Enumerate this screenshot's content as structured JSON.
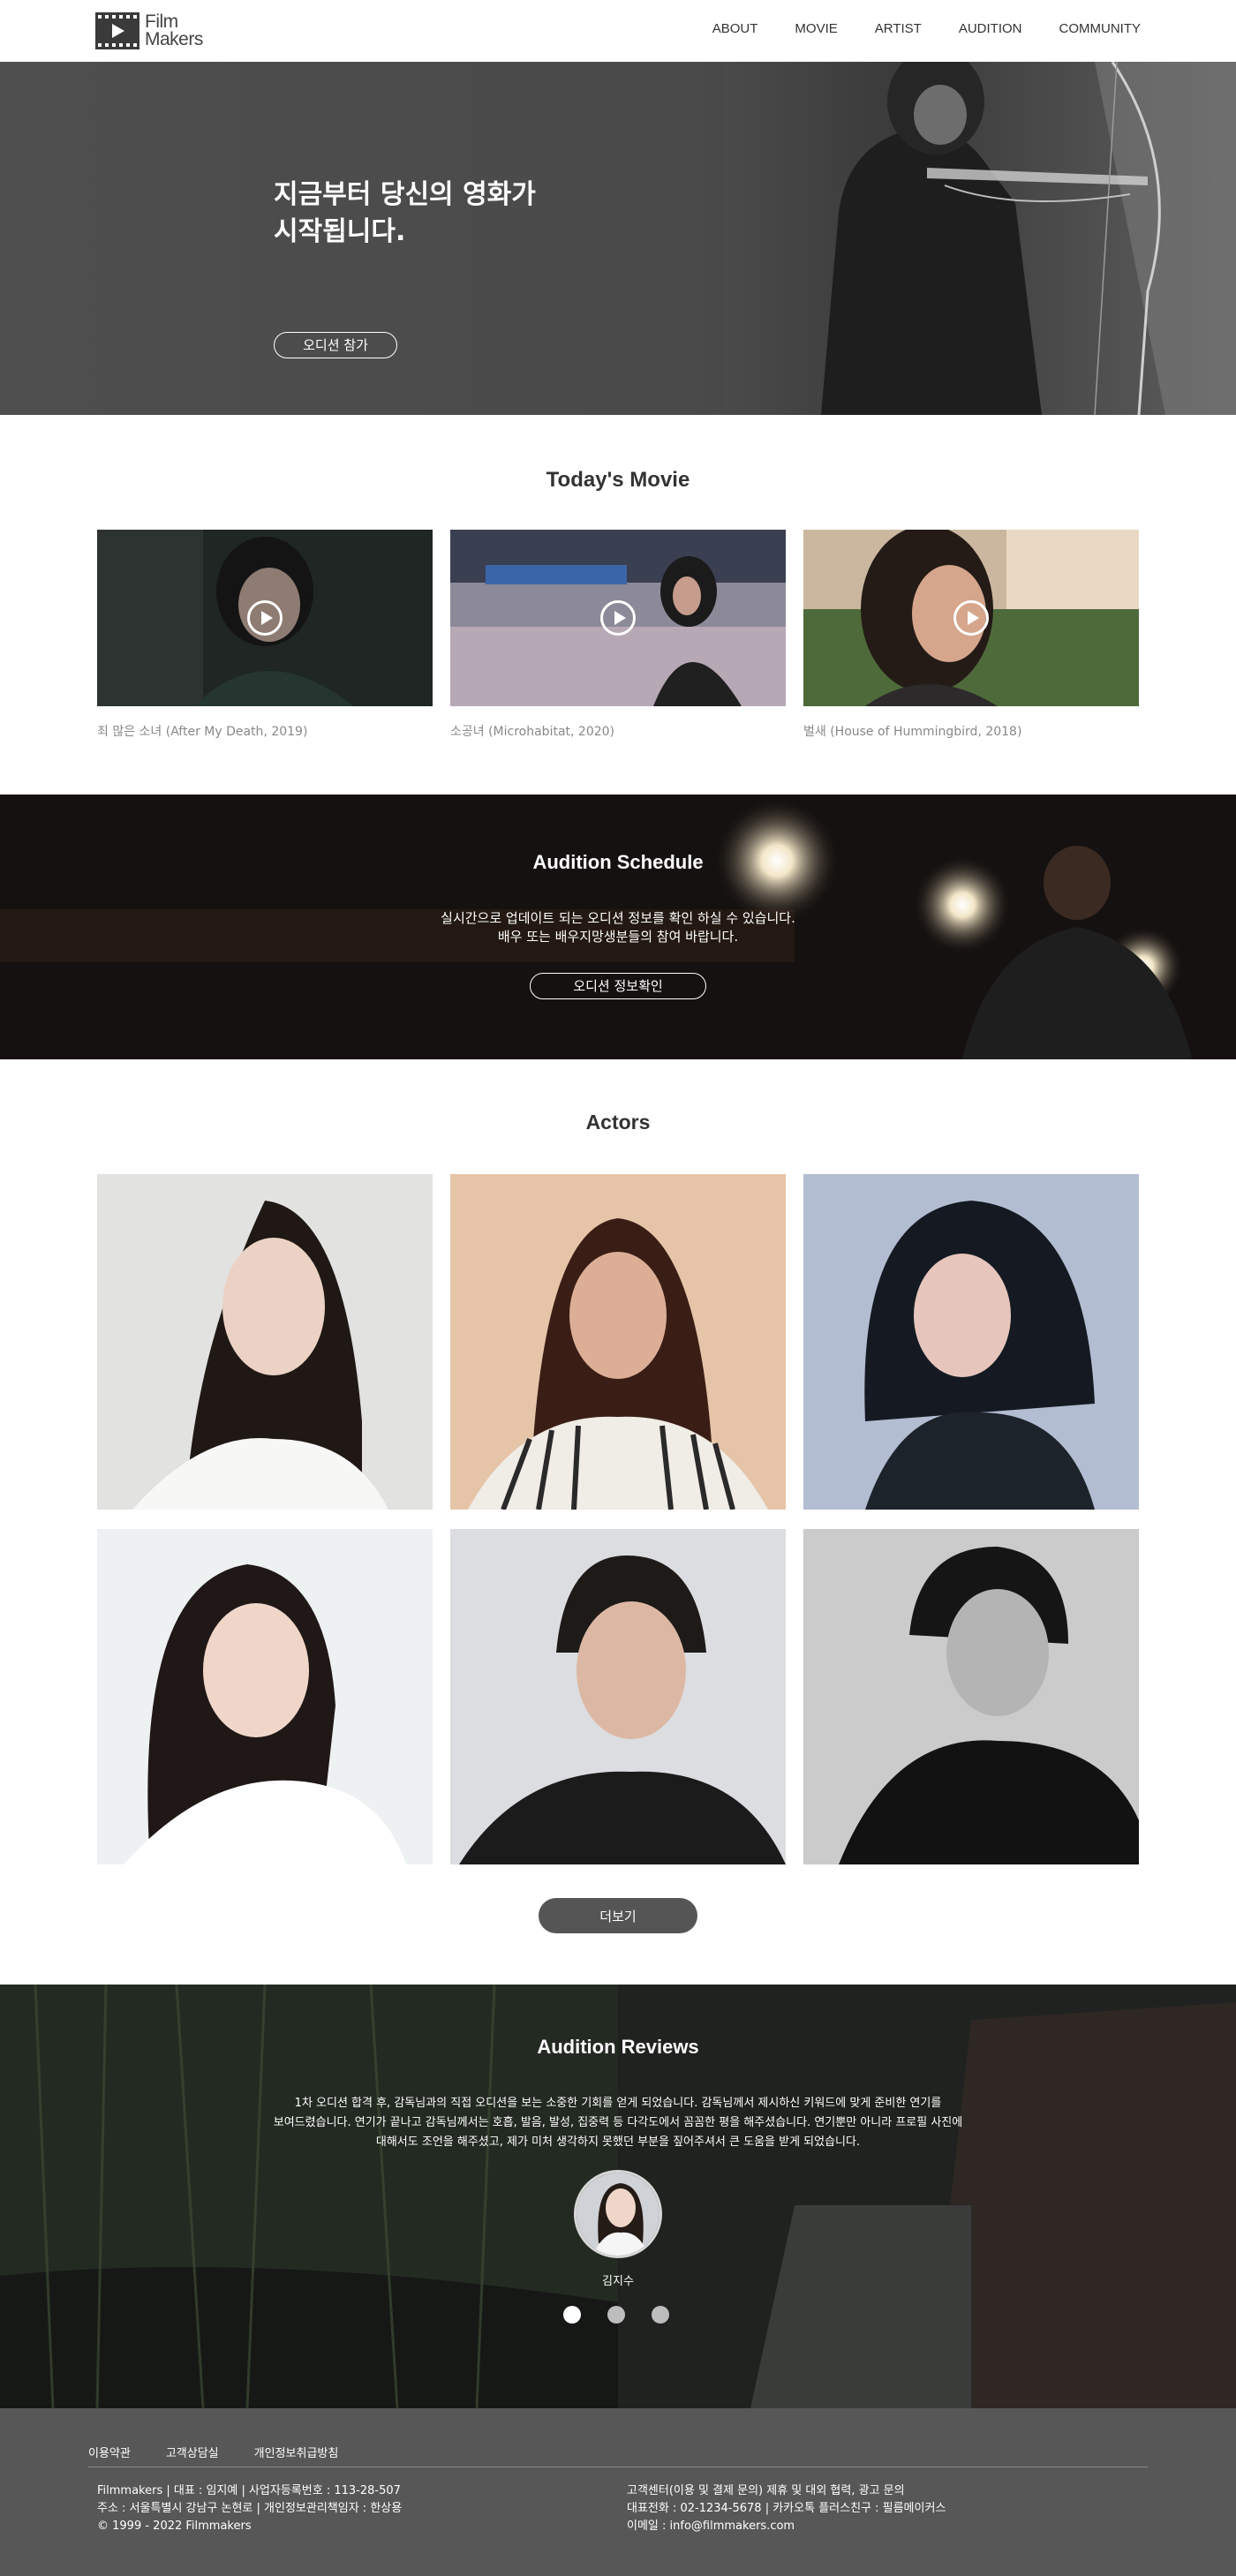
{
  "header": {
    "logo_line1": "Film",
    "logo_line2": "Makers",
    "nav": [
      "ABOUT",
      "MOVIE",
      "ARTIST",
      "AUDITION",
      "COMMUNITY"
    ]
  },
  "hero": {
    "title_line1": "지금부터 당신의 영화가",
    "title_line2": "시작됩니다.",
    "button": "오디션 참가"
  },
  "movies": {
    "title": "Today's Movie",
    "items": [
      {
        "caption": "죄 많은 소녀 (After My Death, 2019)"
      },
      {
        "caption": "소공녀 (Microhabitat, 2020)"
      },
      {
        "caption": "벌새 (House of Hummingbird, 2018)"
      }
    ]
  },
  "schedule": {
    "title": "Audition Schedule",
    "desc_line1": "실시간으로 업데이트 되는 오디션 정보를 확인 하실 수 있습니다.",
    "desc_line2": "배우 또는 배우지망생분들의 참여 바랍니다.",
    "button": "오디션 정보확인"
  },
  "actors": {
    "title": "Actors",
    "more_button": "더보기"
  },
  "reviews": {
    "title": "Audition Reviews",
    "quote_line1": "1차 오디션 합격 후, 감독님과의 직접 오디션을 보는 소중한 기회를 얻게 되었습니다. 감독님께서 제시하신 키워드에 맞게 준비한 연기를",
    "quote_line2": "보여드렸습니다. 연기가 끝나고 감독님께서는 호흡, 발음, 발성, 집중력 등 다각도에서 꼼꼼한 평을 해주셨습니다. 연기뿐만 아니라 프로필 사진에",
    "quote_line3": "대해서도 조언을 해주셨고, 제가 미처 생각하지 못했던 부분을 짚어주셔서 큰 도움을 받게 되었습니다.",
    "reviewer": "김지수",
    "active_slide": 1,
    "slide_count": 3
  },
  "footer": {
    "links": [
      "이용약관",
      "고객상담실",
      "개인정보취급방침"
    ],
    "left": [
      "Filmmakers | 대표 : 임지예 | 사업자등록번호 : 113-28-507",
      "주소 : 서울특별시 강남구 논현로 | 개인정보관리책임자 : 한상용",
      "© 1999 - 2022 Filmmakers"
    ],
    "right": [
      "고객센터(이용 및 결제 문의) 제휴 및 대외 협력, 광고 문의",
      "대표전화 : 02-1234-5678 | 카카오톡 플러스친구 : 필름메이커스",
      "이메일 : info@filmmakers.com"
    ]
  },
  "colors": {
    "hero_bg": "#4a4a4a",
    "schedule_bg": "#121010",
    "more_button_bg": "#555555",
    "footer_bg": "#575757"
  }
}
